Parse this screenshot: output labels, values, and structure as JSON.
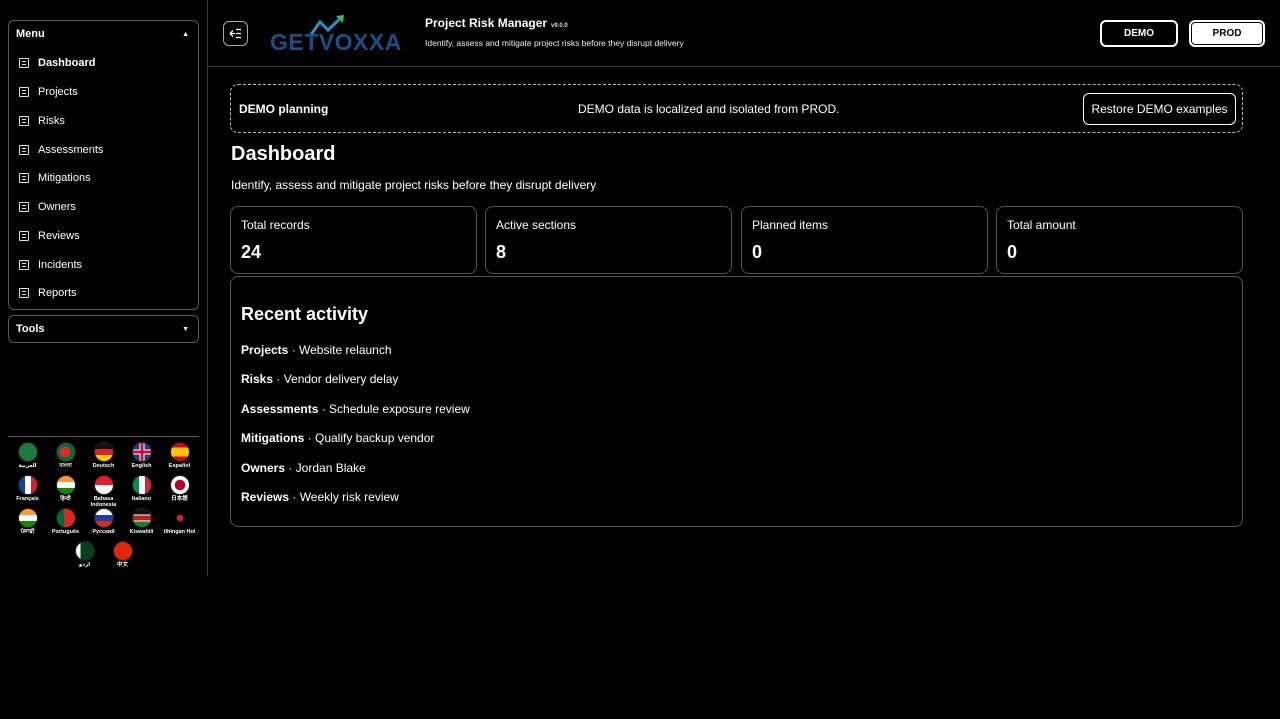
{
  "sidebar": {
    "menu_title": "Menu",
    "menu_items": [
      {
        "label": "Dashboard"
      },
      {
        "label": "Projects"
      },
      {
        "label": "Risks"
      },
      {
        "label": "Assessments"
      },
      {
        "label": "Mitigations"
      },
      {
        "label": "Owners"
      },
      {
        "label": "Reviews"
      },
      {
        "label": "Incidents"
      },
      {
        "label": "Reports"
      }
    ],
    "tools_title": "Tools",
    "languages": [
      {
        "label": "العربية",
        "icon": "flag-saudi-arabia-icon"
      },
      {
        "label": "বাংলা",
        "icon": "flag-bangladesh-icon"
      },
      {
        "label": "Deutsch",
        "icon": "flag-germany-icon"
      },
      {
        "label": "English",
        "icon": "flag-uk-icon"
      },
      {
        "label": "Español",
        "icon": "flag-spain-icon"
      },
      {
        "label": "Français",
        "icon": "flag-france-icon"
      },
      {
        "label": "हिन्दी",
        "icon": "flag-india-icon"
      },
      {
        "label": "Bahasa Indonesia",
        "icon": "flag-indonesia-icon"
      },
      {
        "label": "Italiano",
        "icon": "flag-italy-icon"
      },
      {
        "label": "日本語",
        "icon": "flag-japan-icon"
      },
      {
        "label": "ਪੰਜਾਬੀ",
        "icon": "flag-india-icon"
      },
      {
        "label": "Português",
        "icon": "flag-portugal-icon"
      },
      {
        "label": "Русский",
        "icon": "flag-russia-icon"
      },
      {
        "label": "Kiswahili",
        "icon": "flag-kenya-icon"
      },
      {
        "label": "tlhIngan Hol",
        "icon": "klingon-icon"
      },
      {
        "label": "اردو",
        "icon": "flag-pakistan-icon"
      },
      {
        "label": "中文",
        "icon": "flag-china-icon"
      }
    ]
  },
  "header": {
    "logo_text": "GETVOXXA",
    "app_title": "Project Risk Manager",
    "version": "v9.0.0",
    "subtitle": "Identify, assess and mitigate project risks before they disrupt delivery",
    "demo_label": "DEMO",
    "prod_label": "PROD"
  },
  "banner": {
    "title": "DEMO planning",
    "message": "DEMO data is localized and isolated from PROD.",
    "restore_label": "Restore DEMO examples"
  },
  "main": {
    "title": "Dashboard",
    "subtitle": "Identify, assess and mitigate project risks before they disrupt delivery",
    "stats": [
      {
        "label": "Total records",
        "value": "24"
      },
      {
        "label": "Active sections",
        "value": "8"
      },
      {
        "label": "Planned items",
        "value": "0"
      },
      {
        "label": "Total amount",
        "value": "0"
      }
    ],
    "activity_title": "Recent activity",
    "activity": [
      {
        "section": "Projects",
        "text": " · Website relaunch"
      },
      {
        "section": "Risks",
        "text": " · Vendor delivery delay"
      },
      {
        "section": "Assessments",
        "text": " · Schedule exposure review"
      },
      {
        "section": "Mitigations",
        "text": " · Qualify backup vendor"
      },
      {
        "section": "Owners",
        "text": " · Jordan Blake"
      },
      {
        "section": "Reviews",
        "text": " · Weekly risk review"
      }
    ]
  }
}
